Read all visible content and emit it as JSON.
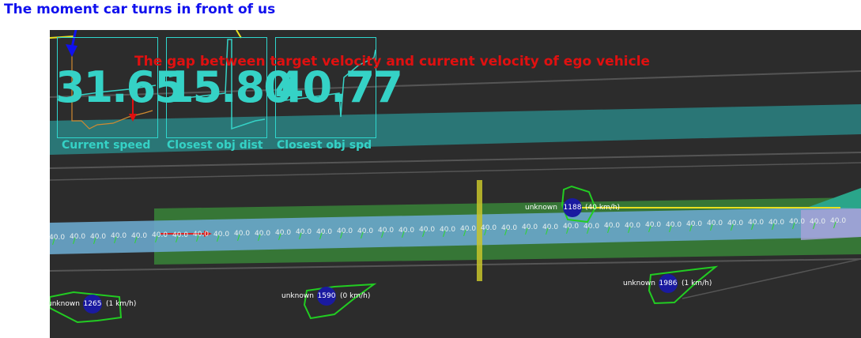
{
  "annotations": {
    "top": "The moment car turns in front of us",
    "gap": "The gap between target velocity and current velocity of ego vehicle"
  },
  "panels": [
    {
      "value": "31.65",
      "label": "Current speed"
    },
    {
      "value": "15.80",
      "label": "Closest obj dist"
    },
    {
      "value": "40.77",
      "label": "Closest obj spd"
    }
  ],
  "objects": [
    {
      "type": "unknown",
      "id": "1188",
      "speed": "(40  km/h)"
    },
    {
      "type": "unknown",
      "id": "1265",
      "speed": "(1  km/h)"
    },
    {
      "type": "unknown",
      "id": "1590",
      "speed": "(0  km/h)"
    },
    {
      "type": "unknown",
      "id": "1986",
      "speed": "(1  km/h)"
    }
  ],
  "path_velocity_label": "40.0",
  "colors": {
    "background": "#2c2c2c",
    "teal_lane": "#2a8a8a",
    "path_blue": "#6aa7cc",
    "green_zone": "#3a8f3a",
    "readout": "#35d2c6",
    "annotation_blue": "#1010ee",
    "annotation_red": "#e01010",
    "object_outline": "#22cc22",
    "object_id_fill": "#1a1aa0"
  }
}
